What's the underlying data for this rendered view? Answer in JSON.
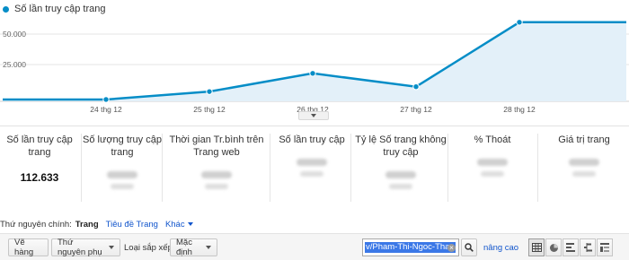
{
  "legend": {
    "label": "Số lần truy cập trang",
    "color": "#058dc7"
  },
  "chart_data": {
    "type": "area",
    "series": [
      {
        "name": "Số lần truy cập trang",
        "values": [
          1500,
          1500,
          8000,
          23000,
          12000,
          65000,
          65000
        ]
      }
    ],
    "x": [
      "",
      "24 thg 12",
      "25 thg 12",
      "26 thg 12",
      "27 thg 12",
      "28 thg 12",
      ""
    ],
    "x_tick_labels": [
      "24 thg 12",
      "25 thg 12",
      "26 thg 12",
      "27 thg 12",
      "28 thg 12"
    ],
    "y_tick_labels": [
      "50.000",
      "25.000"
    ],
    "ylim": [
      0,
      70000
    ],
    "grid": true,
    "line_color": "#058dc7",
    "fill_color": "#e3f0f9"
  },
  "metrics": [
    {
      "label": "Số lần truy cập trang",
      "value": "112.633",
      "blurred": false
    },
    {
      "label": "Số lượng truy cập trang",
      "value": "",
      "blurred": true
    },
    {
      "label": "Thời gian Tr.bình trên Trang web",
      "value": "",
      "blurred": true
    },
    {
      "label": "Số lần truy cập",
      "value": "",
      "blurred": true
    },
    {
      "label": "Tỷ lệ Số trang không truy cập",
      "value": "",
      "blurred": true
    },
    {
      "label": "% Thoát",
      "value": "",
      "blurred": true
    },
    {
      "label": "Giá trị trang",
      "value": "",
      "blurred": true
    }
  ],
  "dimensions": {
    "label": "Thứ nguyên chính:",
    "active": "Trang",
    "links": [
      "Tiêu đề Trang",
      "Khác"
    ]
  },
  "toolbar": {
    "plot_rows": "Vẽ hàng",
    "secondary_dimension": "Thứ nguyên phụ",
    "sort_type_label": "Loại sắp xếp:",
    "sort_default": "Mặc định",
    "search_value": "v/Pham-Thi-Ngoc-Thao",
    "advanced": "nâng cao"
  },
  "view_icons": [
    "table-view-icon",
    "pie-view-icon",
    "performance-view-icon",
    "comparison-view-icon",
    "pivot-view-icon"
  ]
}
